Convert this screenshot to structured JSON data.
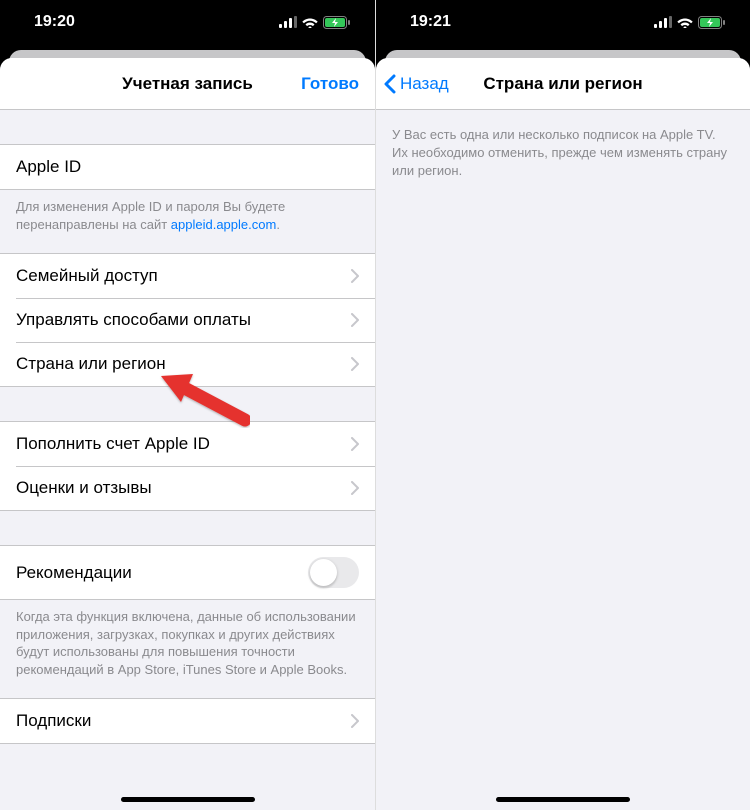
{
  "left": {
    "time": "19:20",
    "nav": {
      "title": "Учетная запись",
      "done": "Готово"
    },
    "rows": {
      "apple_id": "Apple ID",
      "apple_id_footer_prefix": "Для изменения Apple ID и пароля Вы будете перенаправлены на сайт ",
      "apple_id_footer_link": "appleid.apple.com",
      "family": "Семейный доступ",
      "payments": "Управлять способами оплаты",
      "country": "Страна или регион",
      "topup": "Пополнить счет Apple ID",
      "reviews": "Оценки и отзывы",
      "recommend": "Рекомендации",
      "recommend_footer": "Когда эта функция включена, данные об использовании приложения, загрузках, покупках и других действиях будут использованы для повышения точности рекомендаций в App Store, iTunes Store и Apple Books.",
      "subs": "Подписки"
    }
  },
  "right": {
    "time": "19:21",
    "nav": {
      "back": "Назад",
      "title": "Страна или регион"
    },
    "info": "У Вас есть одна или несколько подписок на Apple TV. Их необходимо отменить, прежде чем изменять страну или регион."
  }
}
